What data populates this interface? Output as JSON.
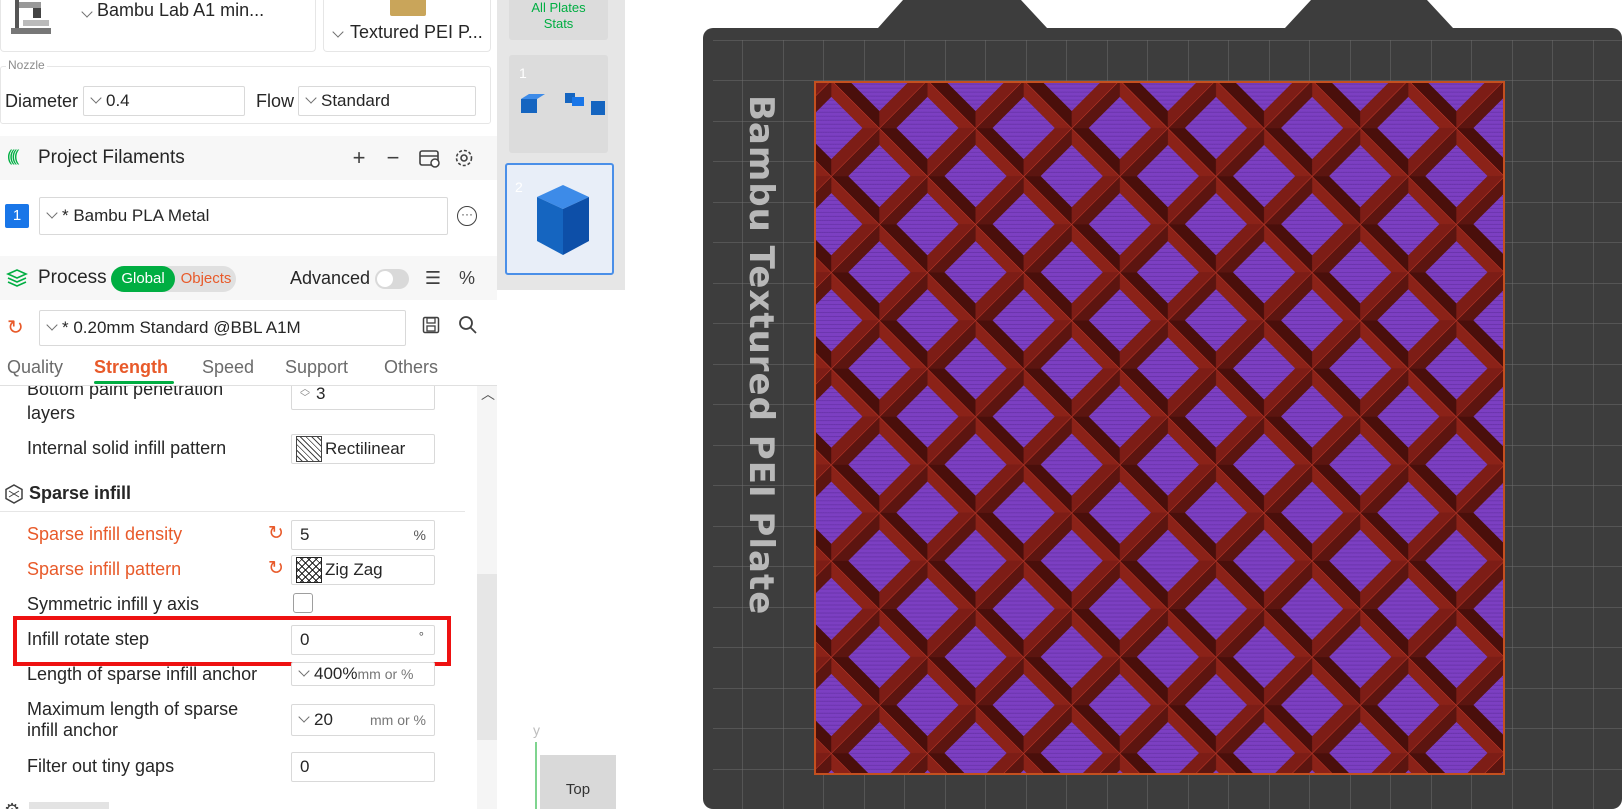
{
  "printer": {
    "name": "Bambu Lab A1 min...",
    "plate_type": "Textured PEI P..."
  },
  "nozzle": {
    "section_label": "Nozzle",
    "diameter_label": "Diameter",
    "diameter_value": "0.4",
    "flow_label": "Flow",
    "flow_value": "Standard"
  },
  "filaments": {
    "title": "Project Filaments",
    "items": [
      {
        "index": "1",
        "name": "* Bambu PLA Metal",
        "color": "#1976e8"
      }
    ]
  },
  "process": {
    "title": "Process",
    "toggle_global": "Global",
    "toggle_objects": "Objects",
    "advanced_label": "Advanced",
    "preset": "* 0.20mm Standard @BBL A1M"
  },
  "tabs": [
    {
      "label": "Quality",
      "active": false
    },
    {
      "label": "Strength",
      "active": true
    },
    {
      "label": "Speed",
      "active": false
    },
    {
      "label": "Support",
      "active": false
    },
    {
      "label": "Others",
      "active": false
    }
  ],
  "settings": {
    "bottom_paint_label_line1": "Bottom paint penetration",
    "bottom_paint_label_line2": "layers",
    "bottom_paint_value": "3",
    "internal_solid_label": "Internal solid infill pattern",
    "internal_solid_value": "Rectilinear",
    "sparse_section": "Sparse infill",
    "density_label": "Sparse infill density",
    "density_value": "5",
    "density_unit": "%",
    "pattern_label": "Sparse infill pattern",
    "pattern_value": "Zig Zag",
    "symmetric_label": "Symmetric infill y axis",
    "rotate_label": "Infill rotate step",
    "rotate_value": "0",
    "rotate_unit": "°",
    "anchor_label": "Length of sparse infill anchor",
    "anchor_value": "400%",
    "anchor_unit": "mm or %",
    "max_anchor_label_line1": "Maximum length of sparse",
    "max_anchor_label_line2": "infill anchor",
    "max_anchor_value": "20",
    "max_anchor_unit": "mm or %",
    "tiny_gaps_label": "Filter out tiny gaps",
    "tiny_gaps_value": "0"
  },
  "plates": {
    "stats_line1": "All Plates",
    "stats_line2": "Stats",
    "plate1_num": "1",
    "plate2_num": "2"
  },
  "viewport": {
    "plate_label": "Bambu Textured PEI Plate",
    "view_button": "Top",
    "axis_label": "y"
  },
  "colors": {
    "accent_green": "#00ae42",
    "accent_orange": "#e85a2a",
    "highlight_red": "#ee1111",
    "bed_dark": "#3d3d3d",
    "infill_red": "#7a1a14",
    "infill_purple": "#7c3fc2"
  }
}
